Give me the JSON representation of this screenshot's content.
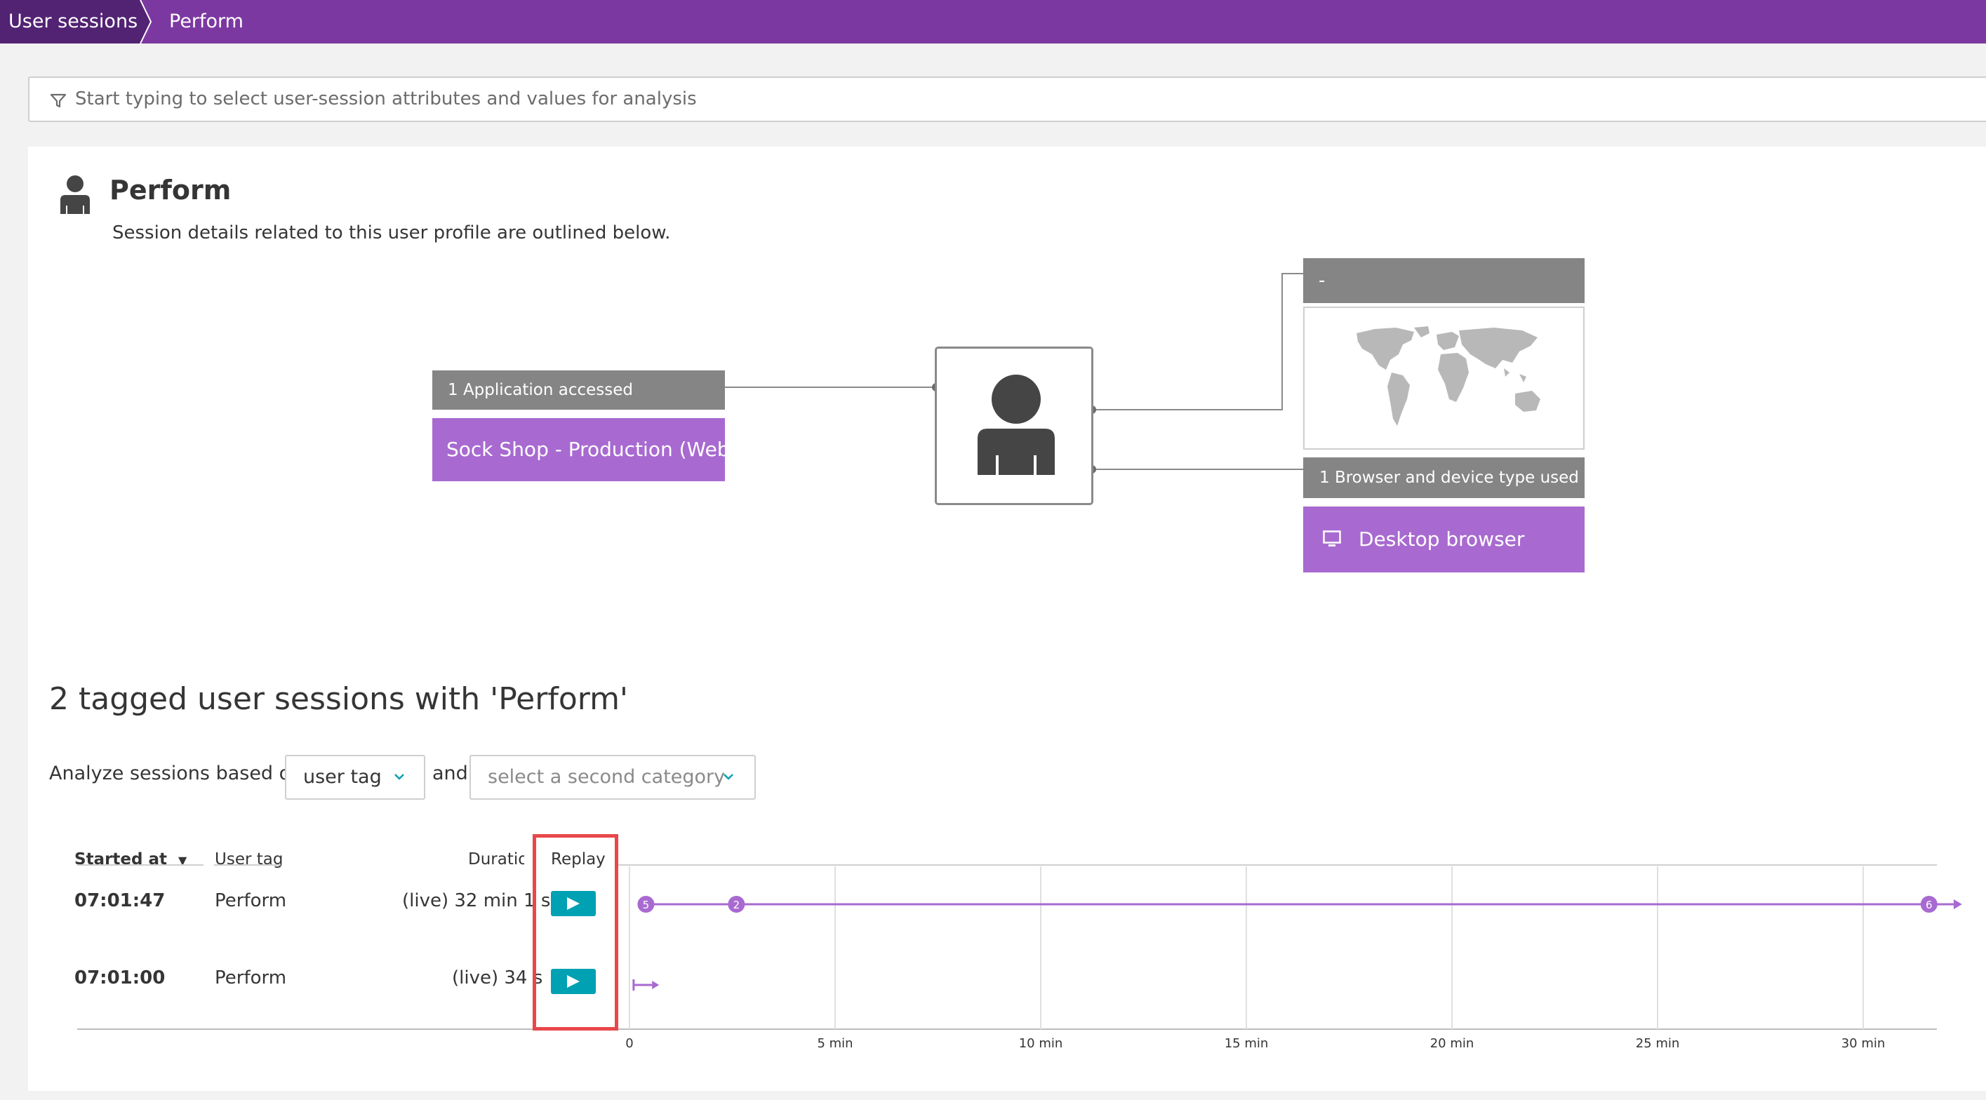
{
  "breadcrumb": {
    "items": [
      "User sessions",
      "Perform"
    ]
  },
  "filter": {
    "placeholder": "Start typing to select user-session attributes and values for analysis"
  },
  "profile": {
    "title": "Perform",
    "subtitle": "Session details related to this user profile are outlined below."
  },
  "diagram": {
    "applications": {
      "header": "1 Application accessed",
      "items": [
        "Sock Shop - Production (Web)"
      ]
    },
    "location": {
      "header": "-"
    },
    "browsers": {
      "header": "1 Browser and device type used",
      "items": [
        "Desktop browser"
      ]
    }
  },
  "sessions": {
    "title": "2 tagged user sessions with 'Perform'",
    "analyze_label": "Analyze sessions based on",
    "primary_category": "user tag",
    "and_label": "and",
    "secondary_placeholder": "select a second category",
    "columns": {
      "started": "Started at",
      "sort_indicator": "▼",
      "user_tag": "User tag",
      "duration": "Duration",
      "replay": "Replay"
    },
    "rows": [
      {
        "started": "07:01:47",
        "user_tag": "Perform",
        "duration": "(live) 32 min 1 s",
        "events": [
          {
            "label": "5",
            "minute": 0.4
          },
          {
            "label": "2",
            "minute": 2.6
          },
          {
            "label": "6",
            "minute": 31.6
          }
        ]
      },
      {
        "started": "07:01:00",
        "user_tag": "Perform",
        "duration": "(live) 34 s",
        "events": []
      }
    ],
    "timeline_ticks": [
      "0",
      "5 min",
      "10 min",
      "15 min",
      "20 min",
      "25 min",
      "30 min"
    ]
  },
  "colors": {
    "brand": "#7c38a1",
    "accent_purple": "#a86ad0",
    "replay_teal": "#00a1b2",
    "highlight_red": "#e8484a"
  },
  "icons": [
    "filter-icon",
    "user-icon",
    "world-map-icon",
    "desktop-icon",
    "chevron-down-icon",
    "play-icon",
    "arrow-right-icon"
  ]
}
